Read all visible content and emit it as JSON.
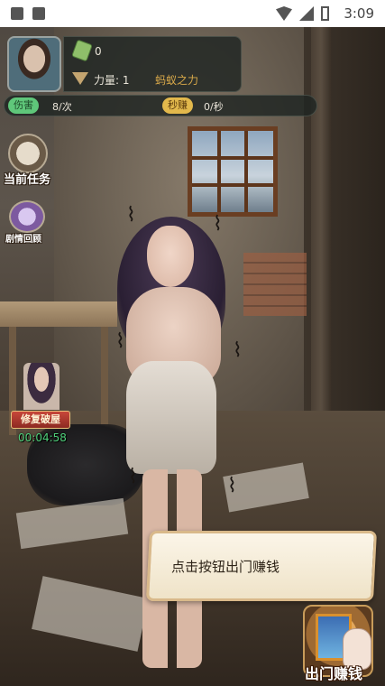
{
  "status_bar": {
    "time": "3:09",
    "left_icons": [
      "image-icon",
      "text-icon"
    ],
    "right_icons": [
      "wifi-icon",
      "signal-icon",
      "battery-icon"
    ]
  },
  "hud": {
    "money": "0",
    "power": "力量: 1",
    "power_title": "蚂蚁之力",
    "damage_badge": "伤害",
    "damage_value": "8/次",
    "per_second_badge": "秒赚",
    "per_second_value": "0/秒"
  },
  "side_buttons": {
    "current_task": "当前任务",
    "story_review": "剧情回顾"
  },
  "repair": {
    "label": "修复破屋",
    "timer": "00:04:58"
  },
  "dialog": {
    "text": "点击按钮出门赚钱"
  },
  "go_out_button": {
    "label": "出门赚钱"
  },
  "colors": {
    "damage_badge": "#5fc77a",
    "per_second_badge": "#e2b84c",
    "power_title": "#d9a94a",
    "timer": "#4fd07a",
    "repair_button": "#c8473a"
  }
}
